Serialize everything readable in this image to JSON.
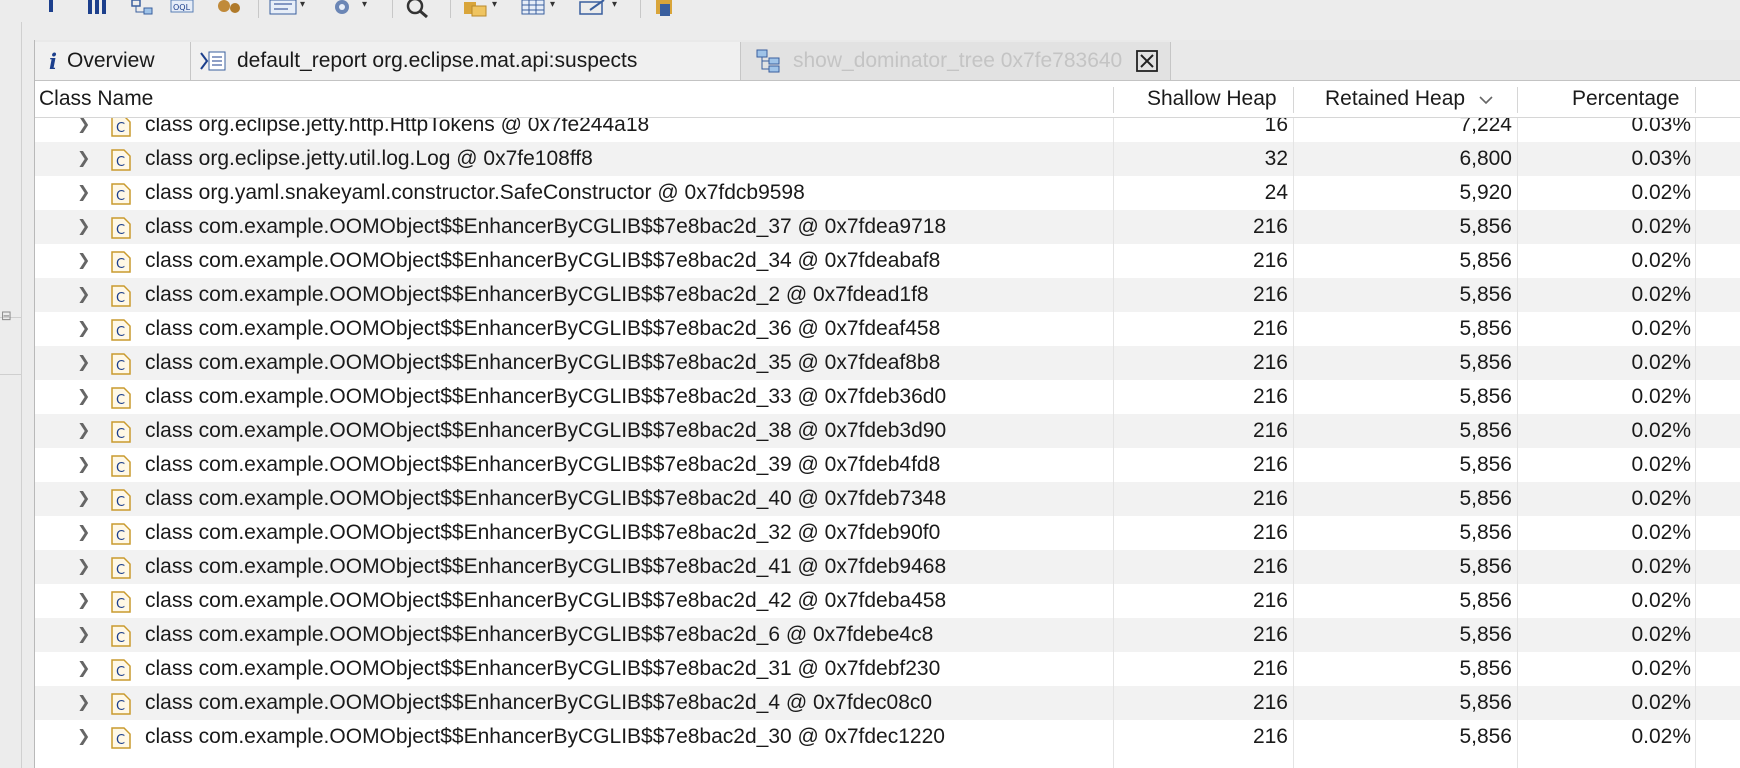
{
  "toolbar": {
    "items": [
      "info-icon",
      "histogram-icon",
      "dominator-tree-icon",
      "oql-icon",
      "heap-dump-overview-icon",
      "run-report-icon",
      "query-browser-icon",
      "search-icon",
      "group-by-icon",
      "calculate-retained-icon",
      "export-icon",
      "open-heap-dump-icon"
    ]
  },
  "tabs": [
    {
      "label": "Overview",
      "icon": "info-icon"
    },
    {
      "label": "default_report  org.eclipse.mat.api:suspects",
      "icon": "report-icon"
    },
    {
      "label": "show_dominator_tree  0x7fe783640",
      "icon": "dominator-tree-icon",
      "active": true
    }
  ],
  "columns": {
    "class_name": "Class Name",
    "shallow_heap": "Shallow Heap",
    "retained_heap": "Retained Heap",
    "percentage": "Percentage"
  },
  "rows": [
    {
      "name": "class org.eclipse.jetty.http.HttpTokens @ 0x7fe244a18",
      "shallow": "16",
      "retained": "7,224",
      "pct": "0.03%"
    },
    {
      "name": "class org.eclipse.jetty.util.log.Log @ 0x7fe108ff8",
      "shallow": "32",
      "retained": "6,800",
      "pct": "0.03%"
    },
    {
      "name": "class org.yaml.snakeyaml.constructor.SafeConstructor @ 0x7fdcb9598",
      "shallow": "24",
      "retained": "5,920",
      "pct": "0.02%"
    },
    {
      "name": "class com.example.OOMObject$$EnhancerByCGLIB$$7e8bac2d_37 @ 0x7fdea9718",
      "shallow": "216",
      "retained": "5,856",
      "pct": "0.02%"
    },
    {
      "name": "class com.example.OOMObject$$EnhancerByCGLIB$$7e8bac2d_34 @ 0x7fdeabaf8",
      "shallow": "216",
      "retained": "5,856",
      "pct": "0.02%"
    },
    {
      "name": "class com.example.OOMObject$$EnhancerByCGLIB$$7e8bac2d_2 @ 0x7fdead1f8",
      "shallow": "216",
      "retained": "5,856",
      "pct": "0.02%"
    },
    {
      "name": "class com.example.OOMObject$$EnhancerByCGLIB$$7e8bac2d_36 @ 0x7fdeaf458",
      "shallow": "216",
      "retained": "5,856",
      "pct": "0.02%"
    },
    {
      "name": "class com.example.OOMObject$$EnhancerByCGLIB$$7e8bac2d_35 @ 0x7fdeaf8b8",
      "shallow": "216",
      "retained": "5,856",
      "pct": "0.02%"
    },
    {
      "name": "class com.example.OOMObject$$EnhancerByCGLIB$$7e8bac2d_33 @ 0x7fdeb36d0",
      "shallow": "216",
      "retained": "5,856",
      "pct": "0.02%"
    },
    {
      "name": "class com.example.OOMObject$$EnhancerByCGLIB$$7e8bac2d_38 @ 0x7fdeb3d90",
      "shallow": "216",
      "retained": "5,856",
      "pct": "0.02%"
    },
    {
      "name": "class com.example.OOMObject$$EnhancerByCGLIB$$7e8bac2d_39 @ 0x7fdeb4fd8",
      "shallow": "216",
      "retained": "5,856",
      "pct": "0.02%"
    },
    {
      "name": "class com.example.OOMObject$$EnhancerByCGLIB$$7e8bac2d_40 @ 0x7fdeb7348",
      "shallow": "216",
      "retained": "5,856",
      "pct": "0.02%"
    },
    {
      "name": "class com.example.OOMObject$$EnhancerByCGLIB$$7e8bac2d_32 @ 0x7fdeb90f0",
      "shallow": "216",
      "retained": "5,856",
      "pct": "0.02%"
    },
    {
      "name": "class com.example.OOMObject$$EnhancerByCGLIB$$7e8bac2d_41 @ 0x7fdeb9468",
      "shallow": "216",
      "retained": "5,856",
      "pct": "0.02%"
    },
    {
      "name": "class com.example.OOMObject$$EnhancerByCGLIB$$7e8bac2d_42 @ 0x7fdeba458",
      "shallow": "216",
      "retained": "5,856",
      "pct": "0.02%"
    },
    {
      "name": "class com.example.OOMObject$$EnhancerByCGLIB$$7e8bac2d_6 @ 0x7fdebe4c8",
      "shallow": "216",
      "retained": "5,856",
      "pct": "0.02%"
    },
    {
      "name": "class com.example.OOMObject$$EnhancerByCGLIB$$7e8bac2d_31 @ 0x7fdebf230",
      "shallow": "216",
      "retained": "5,856",
      "pct": "0.02%"
    },
    {
      "name": "class com.example.OOMObject$$EnhancerByCGLIB$$7e8bac2d_4 @ 0x7fdec08c0",
      "shallow": "216",
      "retained": "5,856",
      "pct": "0.02%"
    },
    {
      "name": "class com.example.OOMObject$$EnhancerByCGLIB$$7e8bac2d_30 @ 0x7fdec1220",
      "shallow": "216",
      "retained": "5,856",
      "pct": "0.02%"
    }
  ],
  "colors": {
    "selection_accent": "#1c3f8c",
    "class_icon": "#c99a2e",
    "alt_row": "#f2f2f2"
  }
}
